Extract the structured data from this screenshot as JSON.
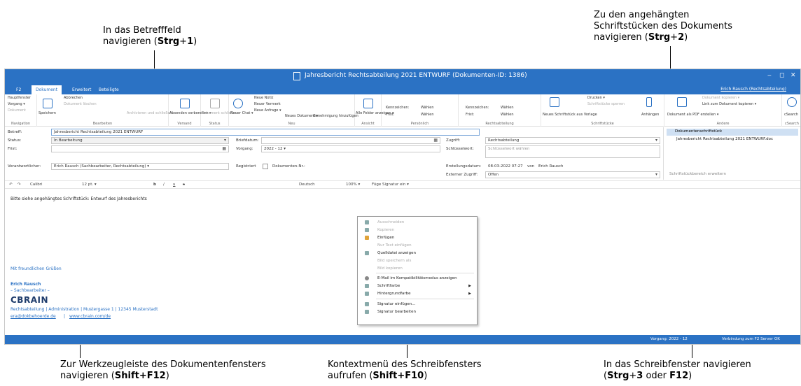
{
  "callouts": {
    "subject": {
      "text": "In das Betrefffeld navigieren (",
      "key1": "Strg",
      "plus": "+",
      "key2": "1",
      "close": ")"
    },
    "attachments": {
      "line1": "Zu den angehängten",
      "line2": "Schriftstücken des Dokuments",
      "line3": "navigieren (",
      "key1": "Strg",
      "plus": "+",
      "key2": "2",
      "close": ")"
    },
    "toolbar": {
      "line1": "Zur Werkzeugleiste des Dokumentenfensters",
      "line2": "navigieren (",
      "key": "Shift+F12",
      "close": ")"
    },
    "context": {
      "line1": "Kontextmenü des Schreibfensters",
      "line2": "aufrufen (",
      "key": "Shift+F10",
      "close": ")"
    },
    "editor": {
      "line1": "In das Schreibfenster navigieren",
      "line2open": "(",
      "key1": "Strg",
      "plus": "+",
      "key2": "3",
      "or": " oder ",
      "key3": "F12",
      "close": ")"
    }
  },
  "window": {
    "title": "Jahresbericht Rechtsabteilung 2021 ENTWURF (Dokumenten-ID: 1386)",
    "controls": [
      "‒",
      "◻",
      "✕"
    ],
    "tabs": [
      "F2",
      "Dokument",
      "Erweitert",
      "Beteiligte"
    ],
    "user": "Erich Rausch (Rechtsabteilung)"
  },
  "ribbon": {
    "navigation": {
      "label": "Navigation",
      "items": [
        "Hauptfenster",
        "Vorgang ▾",
        "Dokument"
      ]
    },
    "bearbeiten": {
      "label": "Bearbeiten",
      "save": "Speichern",
      "cancel": "Abbrechen",
      "delete": "Dokument löschen",
      "archive": "Archivieren und schließen"
    },
    "versand": {
      "label": "Versand",
      "send": "Absenden vorbereiten ▾"
    },
    "status": {
      "label": "Status",
      "close": "Dokument schließen"
    },
    "neu": {
      "label": "Neu",
      "chat": "Neuer Chat ▾",
      "note": "Neue Notiz",
      "memo": "Neuer Vermerk",
      "request": "Neue Anfrage ▾",
      "doc": "Neues Dokument ▾",
      "approval": "Genehmigung hinzufügen"
    },
    "ansicht": {
      "label": "Ansicht",
      "fields": "Alle Felder anzeigen ▾"
    },
    "persoenlich": {
      "label": "Persönlich",
      "k1": "Kennzeichen:",
      "w1": "Wählen",
      "f1": "Frist:",
      "w2": "Wählen"
    },
    "rechts": {
      "label": "Rechtsabteilung",
      "k1": "Kennzeichen:",
      "w1": "Wählen",
      "f1": "Frist:",
      "w2": "Wählen"
    },
    "schriftstuecke": {
      "label": "Schriftstücke",
      "newdoc": "Neues Schriftstück aus Vorlage",
      "print": "Drucken ▾",
      "lock": "Schriftstücke sperren",
      "attach": "Anhängen"
    },
    "andere": {
      "label": "Andere",
      "pdf": "Dokument als PDF erstellen ▾",
      "copy": "Dokument kopieren ▾",
      "link": "Link zum Dokument kopieren ▾"
    },
    "csearch": {
      "label": "cSearch",
      "item": "cSearch"
    }
  },
  "fields": {
    "betreff": {
      "label": "Betreff:",
      "value": "Jahresbericht Rechtsabteilung 2021 ENTWURF"
    },
    "status": {
      "label": "Status:",
      "value": "In Bearbeitung"
    },
    "frist": {
      "label": "Frist:",
      "value": ""
    },
    "verantwortlicher": {
      "label": "Verantwortlicher:",
      "value": "Erich Rausch (Sachbearbeiter, Rechtsabteilung) ▾"
    },
    "briefdatum": {
      "label": "Briefdatum:",
      "value": ""
    },
    "vorgang": {
      "label": "Vorgang:",
      "value": "2022 - 12 ▾"
    },
    "registriert": {
      "label": "Registriert",
      "doknr": "Dokumenten-Nr.:"
    },
    "zugriff": {
      "label": "Zugriff:",
      "value": "Rechtsabteilung"
    },
    "schluesselwort": {
      "label": "Schlüsselwort:",
      "placeholder": "Schlüsselwort wählen"
    },
    "erstellung": {
      "label": "Erstellungsdatum:",
      "value": "08-03-2022 07:27",
      "von": "von",
      "by": "Erich Rausch"
    },
    "externer": {
      "label": "Externer Zugriff:",
      "value": "Offen"
    }
  },
  "attachments": {
    "header": "Dokumentenschriftstück",
    "items": [
      "Jahresbericht Rechtsabteilung 2021 ENTWURF.doc"
    ],
    "expand": "Schriftstückbereich erweitern"
  },
  "toolbar": {
    "font": "Calibri",
    "size": "12 pt. ▾",
    "bold": "b",
    "italic": "/",
    "underline": "u",
    "strike": "s",
    "lang": "Deutsch",
    "zoom": "100% ▾",
    "signature": "Füge Signatur ein ▾"
  },
  "editor": {
    "body": "Bitte siehe angehängtes Schriftstück: Entwurf des Jahresberichts",
    "greeting": "Mit freundlichen Grüßen",
    "name": "Erich Rausch",
    "role": "– Sachbearbeiter –",
    "logo": "CBRAIN",
    "address": "Rechtsabteilung  |  Administration  |  Mustergasse 1  |  12345 Musterstadt",
    "email": "era@dokbehoerde.de",
    "sep": "|",
    "web": "www.cbrain.com/de"
  },
  "context_menu": {
    "items": [
      {
        "label": "Ausschneiden",
        "disabled": true
      },
      {
        "label": "Kopieren",
        "disabled": true
      },
      {
        "label": "Einfügen",
        "disabled": false
      },
      {
        "label": "Nur Text einfügen",
        "disabled": true
      },
      {
        "label": "Quelldatei anzeigen",
        "disabled": false
      },
      {
        "label": "Bild speichern als",
        "disabled": true
      },
      {
        "label": "Bild kopieren",
        "disabled": true
      },
      {
        "label": "E-Mail im Kompatibilitätsmodus anzeigen",
        "disabled": false
      },
      {
        "label": "Schriftfarbe",
        "disabled": false,
        "submenu": true
      },
      {
        "label": "Hintergrundfarbe",
        "disabled": false,
        "submenu": true
      },
      {
        "label": "Signatur einfügen...",
        "disabled": false
      },
      {
        "label": "Signatur bearbeiten",
        "disabled": false
      }
    ]
  },
  "statusbar": {
    "vorgang": "Vorgang: 2022 - 12",
    "connection": "Verbindung zum F2 Server OK"
  }
}
